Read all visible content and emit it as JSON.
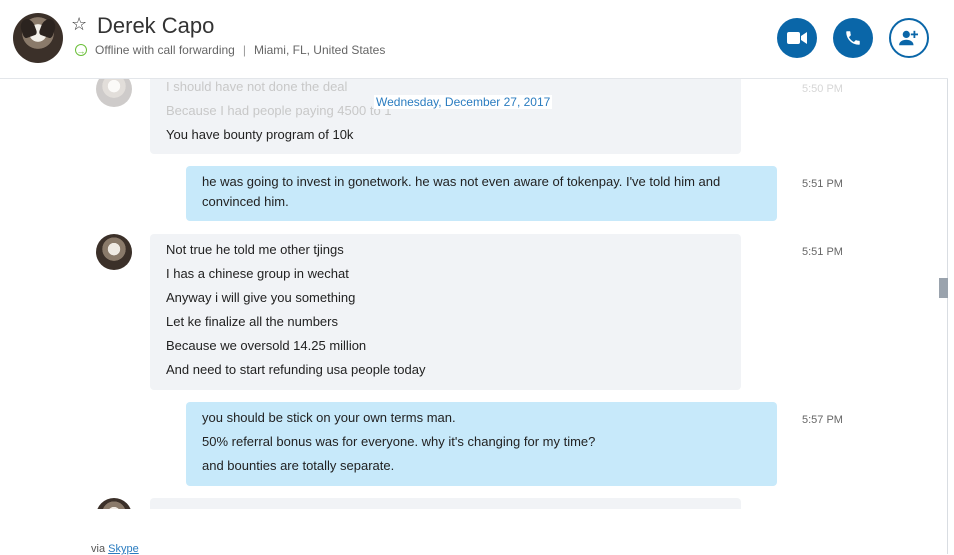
{
  "header": {
    "name": "Derek Capo",
    "status": "Offline with call forwarding",
    "separator": "|",
    "location": "Miami, FL, United States"
  },
  "chat": {
    "date": "Wednesday, December 27, 2017",
    "faded_messages": [
      "I should have not done the deal",
      "Because I had people paying 4500 to 1"
    ],
    "faded_time": "5:50 PM",
    "msg1": {
      "line": "You have bounty program of 10k"
    },
    "msg2": {
      "lines": [
        "he was going to invest in gonetwork. he was not even aware of tokenpay. I've told him and convinced him."
      ],
      "time": "5:51 PM"
    },
    "msg3": {
      "lines": [
        "Not true he told me other tjings",
        "I has a chinese group in wechat",
        "Anyway i will give you something",
        "Let ke finalize all the numbers",
        "Because we oversold 14.25 million",
        "And need to start refunding usa people today"
      ],
      "time": "5:51 PM"
    },
    "msg4": {
      "lines": [
        "you should be stick on your own terms man.",
        "50% referral bonus was for everyone. why it's changing for my time?",
        "and bounties are totally separate."
      ],
      "time": "5:57 PM"
    }
  },
  "footer": {
    "via": "via",
    "link": "Skype"
  },
  "colors": {
    "accent": "#0a66a8",
    "outgoing": "#c7e9fa",
    "incoming": "#f1f3f6",
    "status": "#6bbf3a"
  }
}
